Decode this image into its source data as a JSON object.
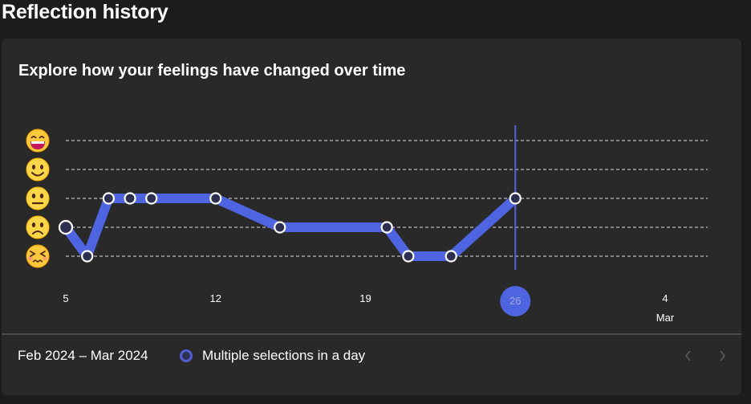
{
  "page": {
    "title": "Reflection history"
  },
  "card": {
    "heading": "Explore how your feelings have changed over time"
  },
  "footer": {
    "date_range": "Feb 2024 – Mar 2024",
    "legend_label": "Multiple selections in a day"
  },
  "colors": {
    "accent": "#4f64e0",
    "marker_fill": "#2c2f4f",
    "grid": "#d8d8d8",
    "card_bg": "#292929",
    "page_bg": "#1c1c1c"
  },
  "icons": {
    "prev": "chevron-left-icon",
    "next": "chevron-right-icon",
    "moods": [
      "grinning-face-icon",
      "smiling-face-icon",
      "neutral-face-icon",
      "frowning-face-icon",
      "confounded-face-icon"
    ]
  },
  "chart_data": {
    "type": "line",
    "y_levels": [
      "grinning",
      "smiling",
      "neutral",
      "frowning",
      "confounded"
    ],
    "y_level_values": [
      5,
      4,
      3,
      2,
      1
    ],
    "x_ticks": [
      {
        "day": 5,
        "label": "5",
        "sublabel": ""
      },
      {
        "day": 12,
        "label": "12",
        "sublabel": ""
      },
      {
        "day": 19,
        "label": "19",
        "sublabel": ""
      },
      {
        "day": 26,
        "label": "26",
        "sublabel": "",
        "selected": true
      },
      {
        "day": 33,
        "label": "4",
        "sublabel": "Mar"
      }
    ],
    "xlim": [
      5,
      33
    ],
    "ylim": [
      1,
      5
    ],
    "grid": true,
    "points": [
      {
        "day": 5,
        "value": 2,
        "multiple": true
      },
      {
        "day": 6,
        "value": 1
      },
      {
        "day": 7,
        "value": 3
      },
      {
        "day": 8,
        "value": 3
      },
      {
        "day": 9,
        "value": 3
      },
      {
        "day": 12,
        "value": 3
      },
      {
        "day": 15,
        "value": 2
      },
      {
        "day": 20,
        "value": 2
      },
      {
        "day": 21,
        "value": 1
      },
      {
        "day": 23,
        "value": 1
      },
      {
        "day": 26,
        "value": 3
      }
    ],
    "selected_day": 26
  }
}
